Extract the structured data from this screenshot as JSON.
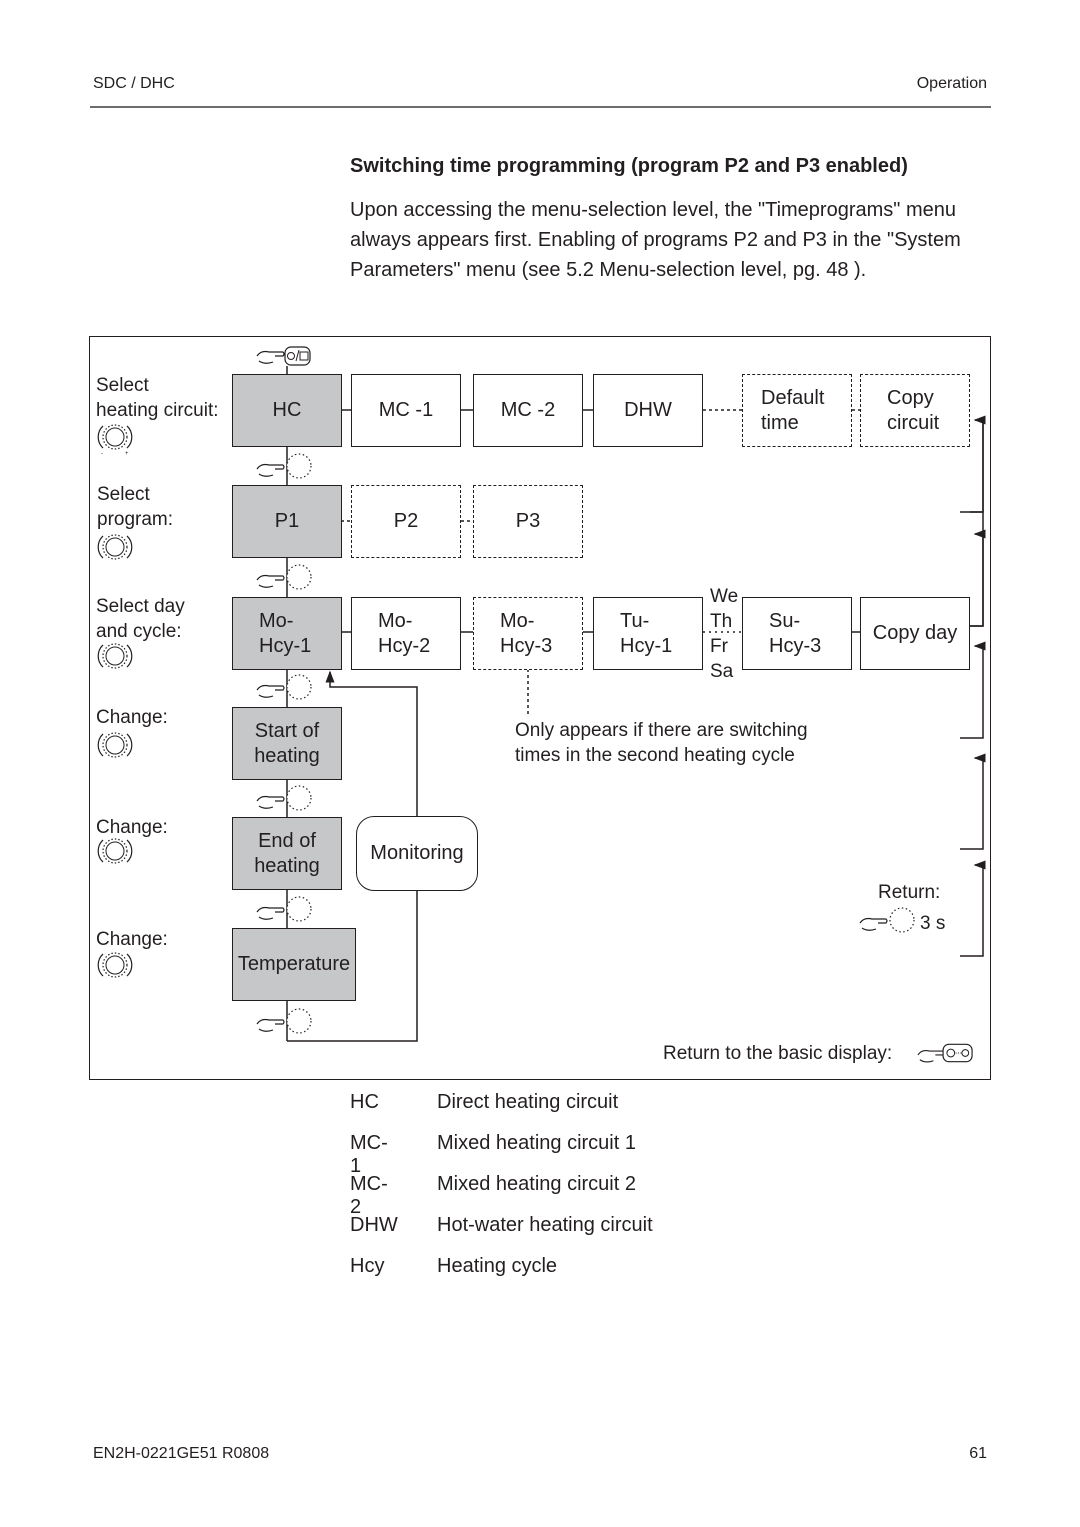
{
  "header": {
    "left": "SDC / DHC",
    "right": "Operation"
  },
  "section": {
    "title": "Switching time programming (program P2 and P3 enabled)",
    "paragraph": "Upon accessing the menu-selection level, the \"Timeprograms\" menu always appears first. Enabling of programs P2 and P3 in the \"System Parameters\" menu (see 5.2 Menu-selection level, pg. 48 )."
  },
  "diagram": {
    "row_labels": {
      "circuit": [
        "Select",
        "heating circuit:"
      ],
      "program": [
        "Select",
        "program:"
      ],
      "day": [
        "Select day",
        "and cycle:"
      ],
      "start": "Change:",
      "end": "Change:",
      "temp": "Change:"
    },
    "circuits": [
      "HC",
      "MC -1",
      "MC -2",
      "DHW"
    ],
    "circuit_extras": {
      "default_time": [
        "Default",
        "time"
      ],
      "copy_circuit": [
        "Copy",
        "circuit"
      ]
    },
    "programs": [
      "P1",
      "P2",
      "P3"
    ],
    "days": [
      [
        "Mo-",
        "Hcy-1"
      ],
      [
        "Mo-",
        "Hcy-2"
      ],
      [
        "Mo-",
        "Hcy-3"
      ],
      [
        "Tu-",
        "Hcy-1"
      ],
      [
        "Su-",
        "Hcy-3"
      ]
    ],
    "day_gap": [
      "We",
      "Th",
      "Fr",
      "Sa"
    ],
    "copy_day": "Copy day",
    "start_of_heating": [
      "Start of",
      "heating"
    ],
    "end_of_heating": [
      "End of",
      "heating"
    ],
    "temperature": "Temperature",
    "monitoring": "Monitoring",
    "note": [
      "Only appears if there are switching",
      "times in the second heating cycle"
    ],
    "return_label": "Return:",
    "return_time": "3 s",
    "return_basic": "Return to the basic display:",
    "icons": {
      "dial": "rotary-knob-icon",
      "press": "press-knob-icon",
      "menu_key": "clock-menu-key-icon",
      "home_key": "home-key-icon"
    }
  },
  "abbreviations": [
    {
      "key": "HC",
      "value": "Direct heating circuit"
    },
    {
      "key": "MC-1",
      "value": "Mixed heating circuit 1"
    },
    {
      "key": "MC-2",
      "value": "Mixed heating circuit 2"
    },
    {
      "key": "DHW",
      "value": "Hot-water heating circuit"
    },
    {
      "key": "Hcy",
      "value": "Heating cycle"
    }
  ],
  "footer": {
    "left": "EN2H-0221GE51 R0808",
    "right": "61"
  },
  "colors": {
    "text": "#231f20",
    "box_fill_active": "#c6c7c9",
    "rule": "#6d6d6d"
  }
}
